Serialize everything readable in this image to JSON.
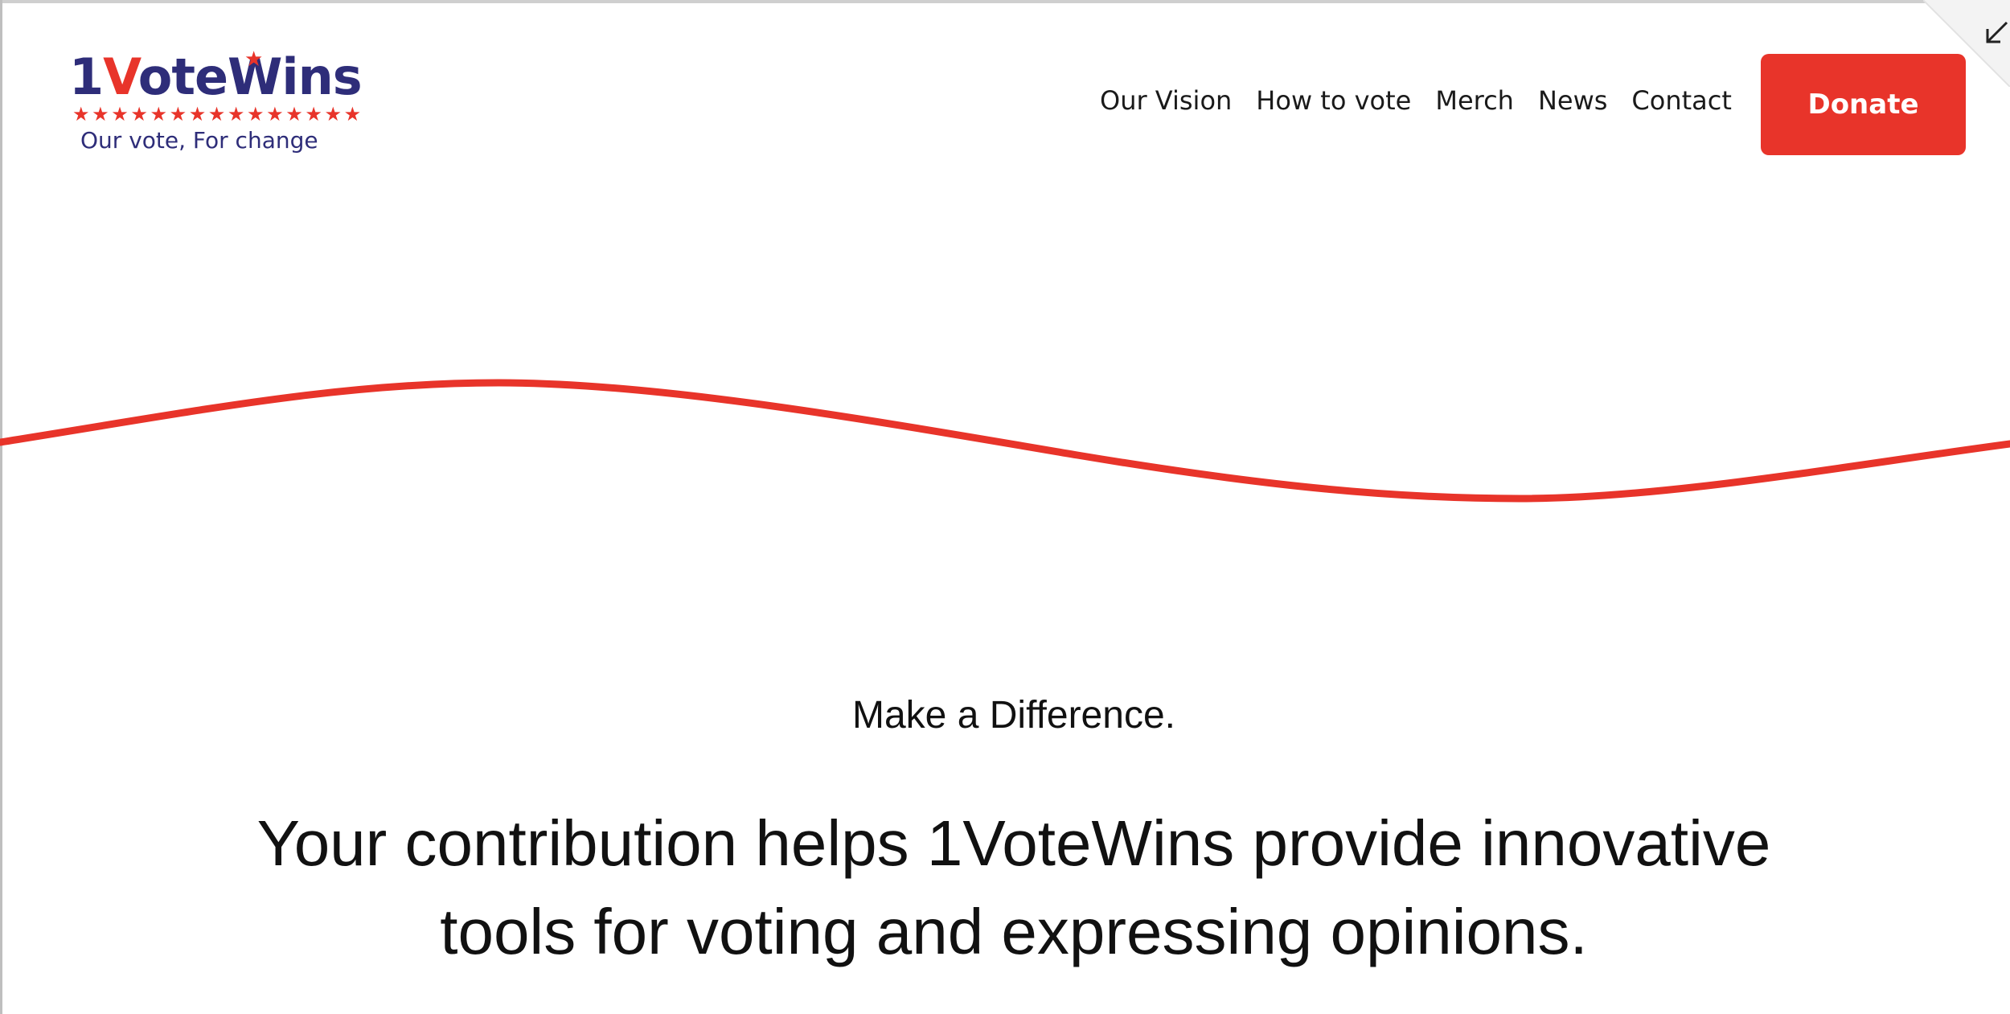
{
  "colors": {
    "brand_red": "#e8342a",
    "brand_navy": "#2e2d79",
    "text": "#111111",
    "background": "#ffffff"
  },
  "logo": {
    "prefix": "1",
    "accent_letter": "V",
    "suffix": "oteWins",
    "stars": "★★★★★★★★★★★★★★★",
    "tagline": "Our vote, For change"
  },
  "nav": {
    "items": [
      {
        "label": "Our Vision"
      },
      {
        "label": "How to vote"
      },
      {
        "label": "Merch"
      },
      {
        "label": "News"
      },
      {
        "label": "Contact"
      }
    ]
  },
  "cta": {
    "donate_label": "Donate"
  },
  "icons": {
    "collapse": "collapse-arrow-icon",
    "logo_star": "star-icon"
  },
  "hero": {
    "eyebrow": "Make a Difference.",
    "headline": "Your contribution helps 1VoteWins provide innovative tools for voting and expressing opinions."
  }
}
